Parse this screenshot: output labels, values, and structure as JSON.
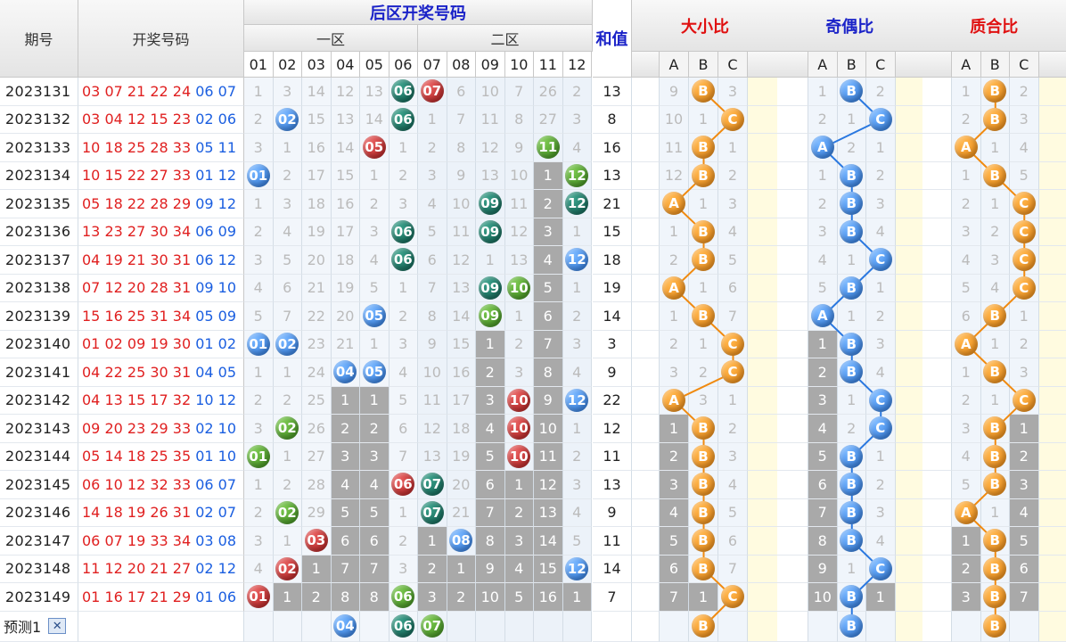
{
  "headers": {
    "period": "期号",
    "draw": "开奖号码",
    "back_zone": "后区开奖号码",
    "zone1": "一区",
    "zone2": "二区",
    "sum": "和值",
    "size_ratio": "大小比",
    "odd_even_ratio": "奇偶比",
    "prime_ratio": "质合比",
    "numbers": [
      "01",
      "02",
      "03",
      "04",
      "05",
      "06",
      "07",
      "08",
      "09",
      "10",
      "11",
      "12"
    ],
    "abc": [
      "A",
      "B",
      "C"
    ]
  },
  "rows": [
    {
      "period": "2023131",
      "front": "03 07 21 22 24",
      "back": "06 07",
      "sum": "13"
    },
    {
      "period": "2023132",
      "front": "03 04 12 15 23",
      "back": "02 06",
      "sum": "8"
    },
    {
      "period": "2023133",
      "front": "10 18 25 28 33",
      "back": "05 11",
      "sum": "16"
    },
    {
      "period": "2023134",
      "front": "10 15 22 27 33",
      "back": "01 12",
      "sum": "13"
    },
    {
      "period": "2023135",
      "front": "05 18 22 28 29",
      "back": "09 12",
      "sum": "21"
    },
    {
      "period": "2023136",
      "front": "13 23 27 30 34",
      "back": "06 09",
      "sum": "15"
    },
    {
      "period": "2023137",
      "front": "04 19 21 30 31",
      "back": "06 12",
      "sum": "18"
    },
    {
      "period": "2023138",
      "front": "07 12 20 28 31",
      "back": "09 10",
      "sum": "19"
    },
    {
      "period": "2023139",
      "front": "15 16 25 31 34",
      "back": "05 09",
      "sum": "14"
    },
    {
      "period": "2023140",
      "front": "01 02 09 19 30",
      "back": "01 02",
      "sum": "3"
    },
    {
      "period": "2023141",
      "front": "04 22 25 30 31",
      "back": "04 05",
      "sum": "9"
    },
    {
      "period": "2023142",
      "front": "04 13 15 17 32",
      "back": "10 12",
      "sum": "22"
    },
    {
      "period": "2023143",
      "front": "09 20 23 29 33",
      "back": "02 10",
      "sum": "12"
    },
    {
      "period": "2023144",
      "front": "05 14 18 25 35",
      "back": "01 10",
      "sum": "11"
    },
    {
      "period": "2023145",
      "front": "06 10 12 32 33",
      "back": "06 07",
      "sum": "13"
    },
    {
      "period": "2023146",
      "front": "14 18 19 26 31",
      "back": "02 07",
      "sum": "9"
    },
    {
      "period": "2023147",
      "front": "06 07 19 33 34",
      "back": "03 08",
      "sum": "11"
    },
    {
      "period": "2023148",
      "front": "11 12 20 21 27",
      "back": "02 12",
      "sum": "14"
    },
    {
      "period": "2023149",
      "front": "01 16 17 21 29",
      "back": "01 06",
      "sum": "7"
    }
  ],
  "number_grid": [
    [
      "1",
      "3",
      "14",
      "12",
      "13",
      "B:06:teal",
      "B:07:red",
      "6",
      "10",
      "7",
      "26",
      "2"
    ],
    [
      "2",
      "B:02:blue",
      "15",
      "13",
      "14",
      "B:06:teal",
      "1",
      "7",
      "11",
      "8",
      "27",
      "3"
    ],
    [
      "3",
      "1",
      "16",
      "14",
      "B:05:red",
      "1",
      "2",
      "8",
      "12",
      "9",
      "B:11:green",
      "4"
    ],
    [
      "B:01:blue",
      "2",
      "17",
      "15",
      "1",
      "2",
      "3",
      "9",
      "13",
      "10",
      "G:1",
      "B:12:green"
    ],
    [
      "1",
      "3",
      "18",
      "16",
      "2",
      "3",
      "4",
      "10",
      "B:09:teal",
      "11",
      "G:2",
      "B:12:teal"
    ],
    [
      "2",
      "4",
      "19",
      "17",
      "3",
      "B:06:teal",
      "5",
      "11",
      "B:09:teal",
      "12",
      "G:3",
      "1"
    ],
    [
      "3",
      "5",
      "20",
      "18",
      "4",
      "B:06:teal",
      "6",
      "12",
      "1",
      "13",
      "G:4",
      "B:12:blue"
    ],
    [
      "4",
      "6",
      "21",
      "19",
      "5",
      "1",
      "7",
      "13",
      "B:09:teal",
      "B:10:green",
      "G:5",
      "1"
    ],
    [
      "5",
      "7",
      "22",
      "20",
      "B:05:blue",
      "2",
      "8",
      "14",
      "B:09:green",
      "1",
      "G:6",
      "2"
    ],
    [
      "B:01:blue",
      "B:02:blue",
      "23",
      "21",
      "1",
      "3",
      "9",
      "15",
      "G:1",
      "2",
      "G:7",
      "3"
    ],
    [
      "1",
      "1",
      "24",
      "B:04:blue",
      "B:05:blue",
      "4",
      "10",
      "16",
      "G:2",
      "3",
      "G:8",
      "4"
    ],
    [
      "2",
      "2",
      "25",
      "G:1",
      "G:1",
      "5",
      "11",
      "17",
      "G:3",
      "B:10:red",
      "G:9",
      "B:12:blue"
    ],
    [
      "3",
      "B:02:green",
      "26",
      "G:2",
      "G:2",
      "6",
      "12",
      "18",
      "G:4",
      "B:10:red",
      "G:10",
      "1"
    ],
    [
      "B:01:green",
      "1",
      "27",
      "G:3",
      "G:3",
      "7",
      "13",
      "19",
      "G:5",
      "B:10:red",
      "G:11",
      "2"
    ],
    [
      "1",
      "2",
      "28",
      "G:4",
      "G:4",
      "B:06:red",
      "B:07:teal",
      "20",
      "G:6",
      "G:1",
      "G:12",
      "3"
    ],
    [
      "2",
      "B:02:green",
      "29",
      "G:5",
      "G:5",
      "1",
      "B:07:teal",
      "21",
      "G:7",
      "G:2",
      "G:13",
      "4"
    ],
    [
      "3",
      "1",
      "B:03:red",
      "G:6",
      "G:6",
      "2",
      "G:1",
      "B:08:blue",
      "G:8",
      "G:3",
      "G:14",
      "5"
    ],
    [
      "4",
      "B:02:red",
      "G:1",
      "G:7",
      "G:7",
      "3",
      "G:2",
      "G:1",
      "G:9",
      "G:4",
      "G:15",
      "B:12:blue"
    ],
    [
      "B:01:red",
      "G:1",
      "G:2",
      "G:8",
      "G:8",
      "B:06:green",
      "G:3",
      "G:2",
      "G:10",
      "G:5",
      "G:16",
      "G:1"
    ]
  ],
  "prediction": {
    "label": "预测1",
    "close": "✕",
    "balls": [
      {
        "col": 3,
        "text": "04",
        "color": "blue"
      },
      {
        "col": 5,
        "text": "06",
        "color": "teal"
      },
      {
        "col": 6,
        "text": "07",
        "color": "green"
      }
    ],
    "size": "B",
    "oddeven": "B",
    "prime": "B"
  },
  "size_grid": [
    [
      "9",
      "B",
      "3"
    ],
    [
      "10",
      "1",
      "C"
    ],
    [
      "11",
      "B",
      "1"
    ],
    [
      "12",
      "B",
      "2"
    ],
    [
      "A",
      "1",
      "3"
    ],
    [
      "1",
      "B",
      "4"
    ],
    [
      "2",
      "B",
      "5"
    ],
    [
      "A",
      "1",
      "6"
    ],
    [
      "1",
      "B",
      "7"
    ],
    [
      "2",
      "1",
      "C"
    ],
    [
      "3",
      "2",
      "C"
    ],
    [
      "A",
      "3",
      "1"
    ],
    [
      "G:1",
      "B",
      "2"
    ],
    [
      "G:2",
      "B",
      "3"
    ],
    [
      "G:3",
      "B",
      "4"
    ],
    [
      "G:4",
      "B",
      "5"
    ],
    [
      "G:5",
      "B",
      "6"
    ],
    [
      "G:6",
      "B",
      "7"
    ],
    [
      "G:7",
      "G:1",
      "C"
    ]
  ],
  "oddeven_grid": [
    [
      "1",
      "B",
      "2"
    ],
    [
      "2",
      "1",
      "C"
    ],
    [
      "A",
      "2",
      "1"
    ],
    [
      "1",
      "B",
      "2"
    ],
    [
      "2",
      "B",
      "3"
    ],
    [
      "3",
      "B",
      "4"
    ],
    [
      "4",
      "1",
      "C"
    ],
    [
      "5",
      "B",
      "1"
    ],
    [
      "A",
      "1",
      "2"
    ],
    [
      "G:1",
      "B",
      "3"
    ],
    [
      "G:2",
      "B",
      "4"
    ],
    [
      "G:3",
      "1",
      "C"
    ],
    [
      "G:4",
      "2",
      "C"
    ],
    [
      "G:5",
      "B",
      "1"
    ],
    [
      "G:6",
      "B",
      "2"
    ],
    [
      "G:7",
      "B",
      "3"
    ],
    [
      "G:8",
      "B",
      "4"
    ],
    [
      "G:9",
      "1",
      "C"
    ],
    [
      "G:10",
      "B",
      "G:1"
    ]
  ],
  "prime_grid": [
    [
      "1",
      "B",
      "2"
    ],
    [
      "2",
      "B",
      "3"
    ],
    [
      "A",
      "1",
      "4"
    ],
    [
      "1",
      "B",
      "5"
    ],
    [
      "2",
      "1",
      "C"
    ],
    [
      "3",
      "2",
      "C"
    ],
    [
      "4",
      "3",
      "C"
    ],
    [
      "5",
      "4",
      "C"
    ],
    [
      "6",
      "B",
      "1"
    ],
    [
      "A",
      "1",
      "2"
    ],
    [
      "1",
      "B",
      "3"
    ],
    [
      "2",
      "1",
      "C"
    ],
    [
      "3",
      "B",
      "G:1"
    ],
    [
      "4",
      "B",
      "G:2"
    ],
    [
      "5",
      "B",
      "G:3"
    ],
    [
      "A",
      "1",
      "G:4"
    ],
    [
      "G:1",
      "B",
      "G:5"
    ],
    [
      "G:2",
      "B",
      "G:6"
    ],
    [
      "G:3",
      "B",
      "G:7"
    ]
  ],
  "colors": {
    "front": "#e02020",
    "back": "#1a5ee0",
    "header_blue": "#1a22c8",
    "header_red": "#e01010"
  }
}
